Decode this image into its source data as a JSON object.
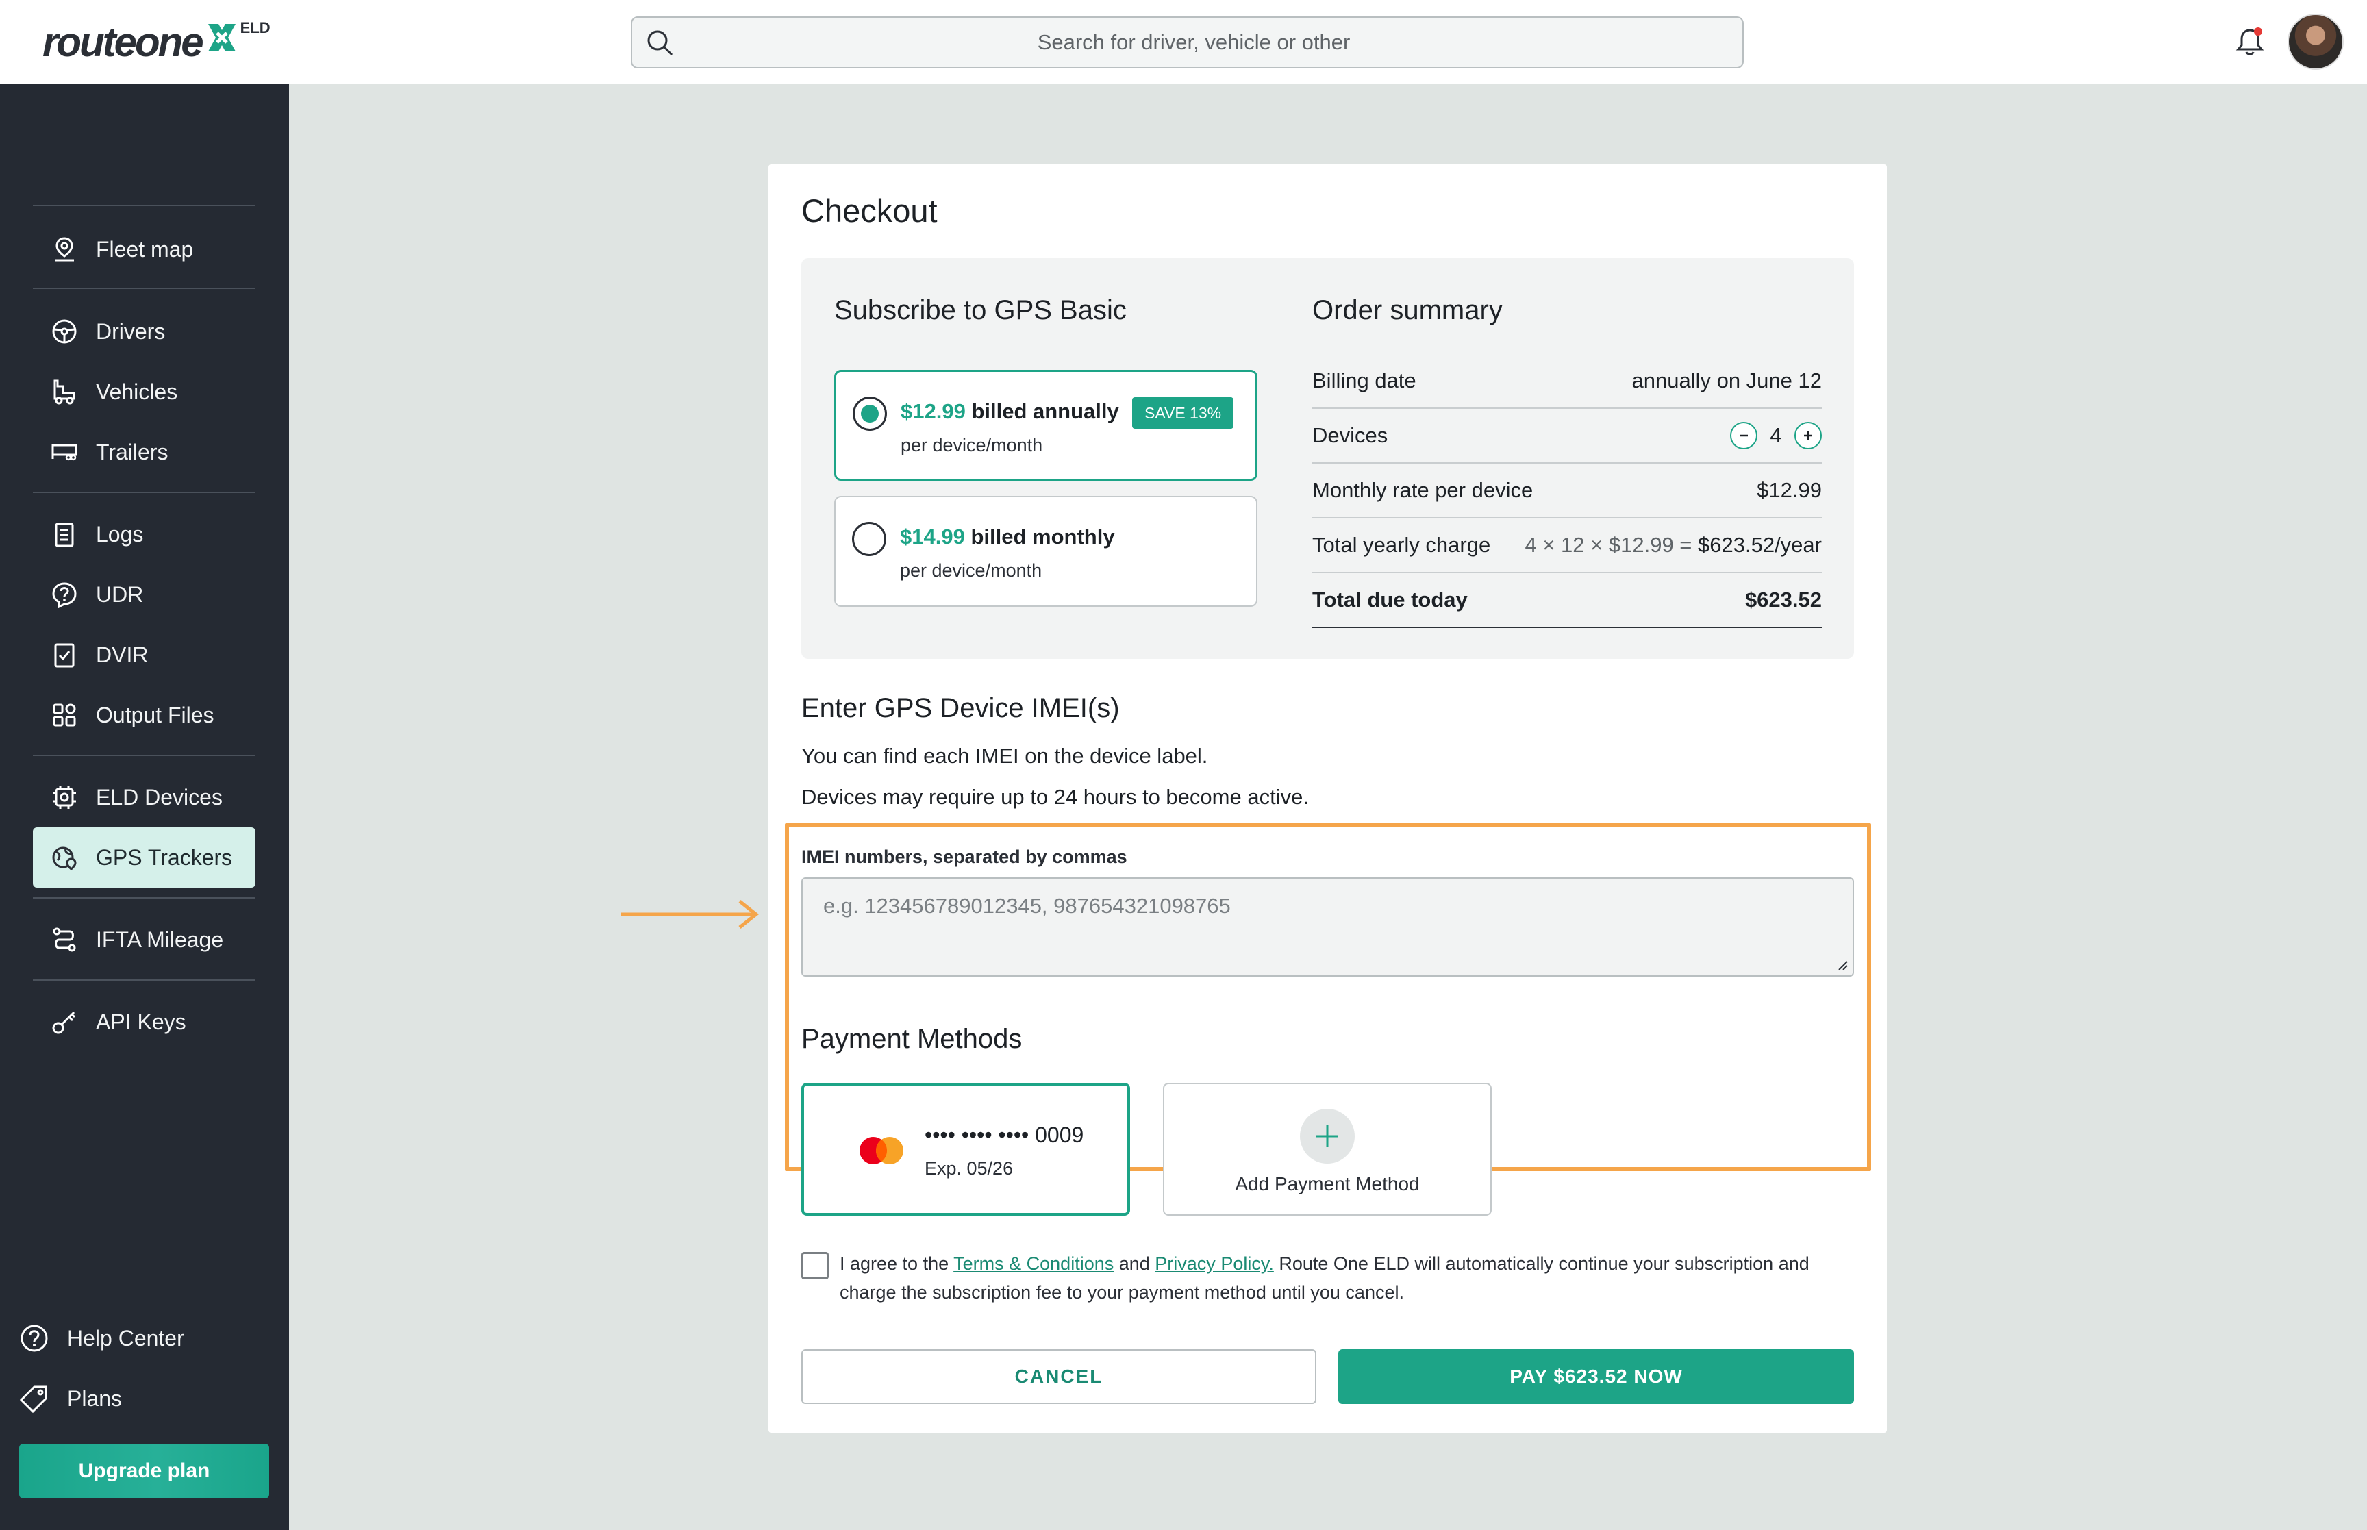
{
  "app": {
    "logo_text": "routeone",
    "logo_sup": "ELD",
    "search_placeholder": "Search for driver, vehicle or other"
  },
  "sidebar": {
    "items": [
      {
        "label": "Fleet map",
        "icon": "map-pin-icon"
      },
      {
        "label": "Drivers",
        "icon": "steering-wheel-icon"
      },
      {
        "label": "Vehicles",
        "icon": "truck-icon"
      },
      {
        "label": "Trailers",
        "icon": "trailer-icon"
      },
      {
        "label": "Logs",
        "icon": "clipboard-icon"
      },
      {
        "label": "UDR",
        "icon": "question-circle-icon"
      },
      {
        "label": "DVIR",
        "icon": "checklist-icon"
      },
      {
        "label": "Output Files",
        "icon": "grid-icon"
      },
      {
        "label": "ELD Devices",
        "icon": "device-icon"
      },
      {
        "label": "GPS Trackers",
        "icon": "gps-icon",
        "active": true
      },
      {
        "label": "IFTA Mileage",
        "icon": "route-icon"
      },
      {
        "label": "API Keys",
        "icon": "key-icon"
      }
    ],
    "footer": [
      {
        "label": "Help Center",
        "icon": "help-icon"
      },
      {
        "label": "Plans",
        "icon": "tag-icon"
      }
    ],
    "upgrade_label": "Upgrade plan"
  },
  "checkout": {
    "title": "Checkout",
    "subscribe_title": "Subscribe to GPS Basic",
    "plans": [
      {
        "price": "$12.99",
        "billing": " billed annually",
        "per": "per device/month",
        "badge": "SAVE 13%",
        "selected": true
      },
      {
        "price": "$14.99",
        "billing": " billed monthly",
        "per": "per device/month",
        "selected": false
      }
    ],
    "summary": {
      "title": "Order summary",
      "billing_date_label": "Billing date",
      "billing_date_value": "annually on June 12",
      "devices_label": "Devices",
      "devices_value": "4",
      "monthly_rate_label": "Monthly rate per device",
      "monthly_rate_value": "$12.99",
      "yearly_label": "Total yearly charge",
      "yearly_calc": "4 × 12 × $12.99 = ",
      "yearly_value": "$623.52/year",
      "total_label": "Total due today",
      "total_value": "$623.52"
    },
    "imei": {
      "title": "Enter GPS Device IMEI(s)",
      "line1": "You can find each IMEI on the device label.",
      "line2": "Devices may require up to 24 hours to become active.",
      "label": "IMEI numbers, separated by commas",
      "placeholder": "e.g. 123456789012345, 987654321098765"
    },
    "payment": {
      "title": "Payment Methods",
      "card_number": "•••• •••• •••• 0009",
      "card_exp": "Exp. 05/26",
      "add_label": "Add Payment Method"
    },
    "agreement": {
      "prefix": "I agree to the ",
      "terms": "Terms & Conditions",
      "and": " and ",
      "privacy": "Privacy Policy.",
      "suffix": " Route One ELD will automatically continue your subscription and charge the subscription fee to your payment method until you cancel."
    },
    "cancel_label": "CANCEL",
    "pay_label": "PAY $623.52 NOW"
  },
  "colors": {
    "accent": "#1da487",
    "sidebar_bg": "#252a33",
    "highlight": "#f5a54a",
    "page_bg": "#dfe4e2"
  }
}
